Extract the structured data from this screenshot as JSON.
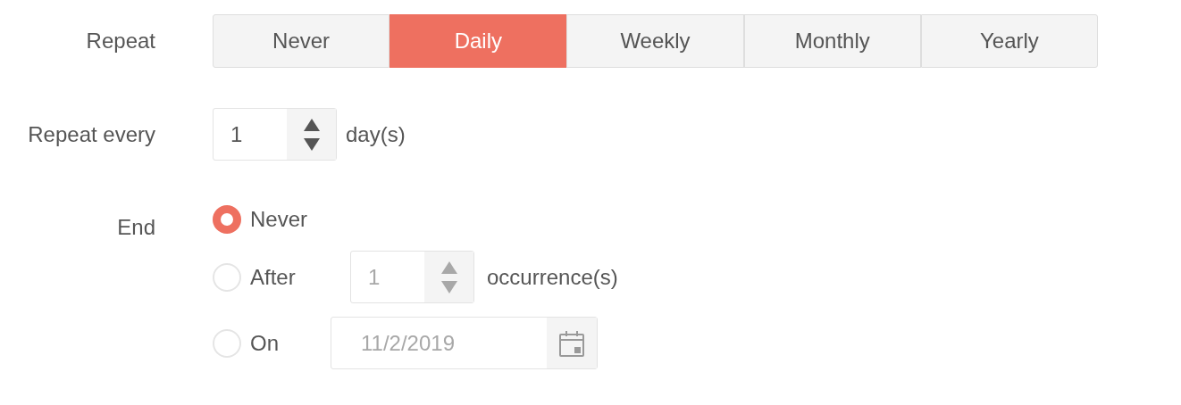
{
  "repeat": {
    "label": "Repeat",
    "options": [
      {
        "label": "Never",
        "selected": false
      },
      {
        "label": "Daily",
        "selected": true
      },
      {
        "label": "Weekly",
        "selected": false
      },
      {
        "label": "Monthly",
        "selected": false
      },
      {
        "label": "Yearly",
        "selected": false
      }
    ]
  },
  "repeat_every": {
    "label": "Repeat every",
    "value": "1",
    "unit": "day(s)"
  },
  "end": {
    "label": "End",
    "options": [
      {
        "kind": "plain",
        "label": "Never",
        "selected": true
      },
      {
        "kind": "count",
        "label": "After",
        "selected": false,
        "value": "1",
        "unit": "occurrence(s)",
        "disabled": true
      },
      {
        "kind": "date",
        "label": "On",
        "selected": false,
        "value": "11/2/2019",
        "disabled": true
      }
    ]
  }
}
